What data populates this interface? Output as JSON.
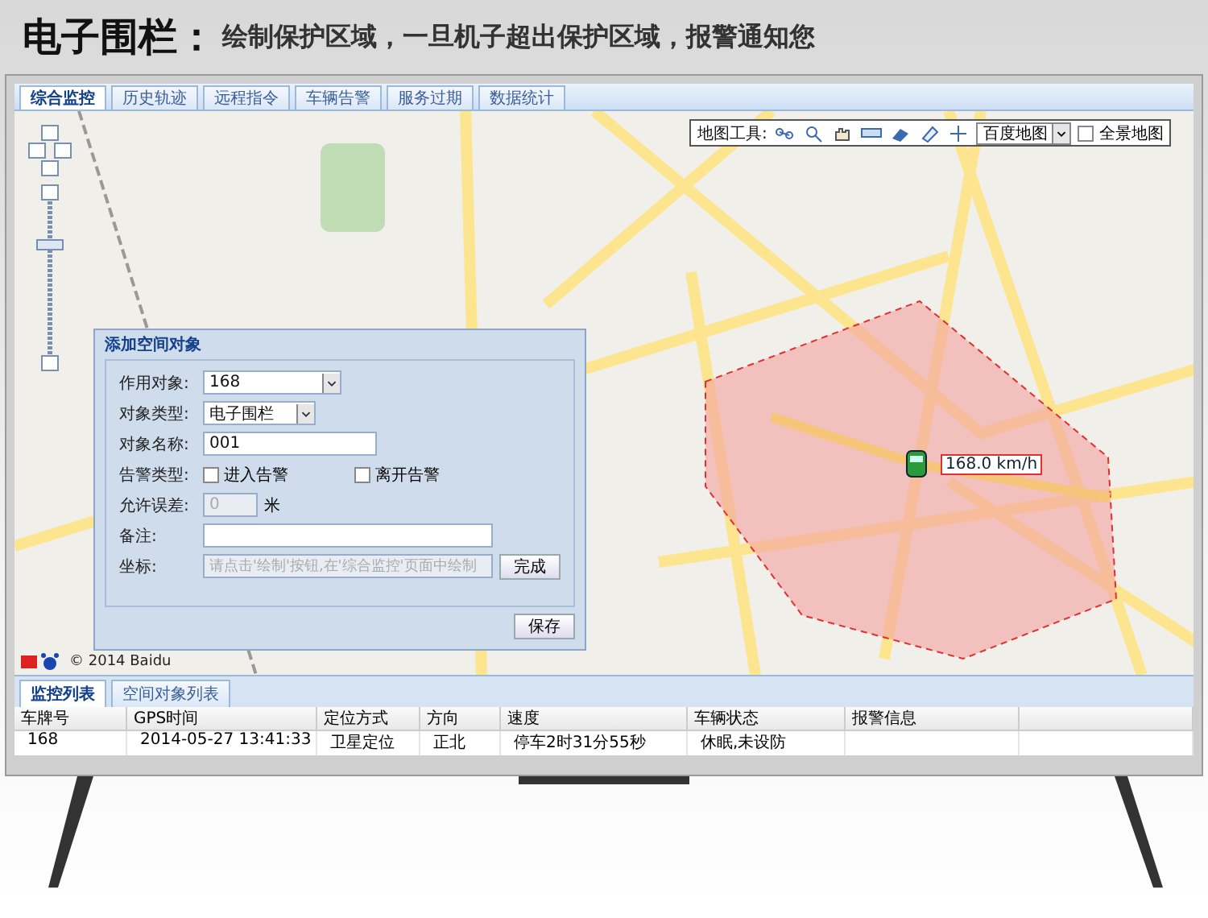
{
  "headline": {
    "title": "电子围栏：",
    "subtitle": "绘制保护区域，一旦机子超出保护区域，报警通知您"
  },
  "tabs": [
    {
      "label": "综合监控",
      "selected": true
    },
    {
      "label": "历史轨迹",
      "selected": false
    },
    {
      "label": "远程指令",
      "selected": false
    },
    {
      "label": "车辆告警",
      "selected": false
    },
    {
      "label": "服务过期",
      "selected": false
    },
    {
      "label": "数据统计",
      "selected": false
    }
  ],
  "map_toolbar": {
    "label": "地图工具:",
    "map_type": "百度地图",
    "panorama": {
      "label": "全景地图",
      "checked": false
    }
  },
  "vehicle": {
    "speed": "168.0 km/h"
  },
  "map_copyright": "© 2014 Baidu",
  "dialog": {
    "title": "添加空间对象",
    "fields": [
      {
        "kind": "select",
        "label": "作用对象:",
        "value": "168"
      },
      {
        "kind": "select",
        "label": "对象类型:",
        "value": "电子围栏"
      },
      {
        "kind": "text",
        "label": "对象名称:",
        "value": "001"
      },
      {
        "kind": "checks",
        "label": "告警类型:",
        "options": [
          {
            "label": "进入告警",
            "checked": false
          },
          {
            "label": "离开告警",
            "checked": false
          }
        ]
      },
      {
        "kind": "number",
        "label": "允许误差:",
        "value": "0",
        "unit": "米",
        "disabled": true
      },
      {
        "kind": "text",
        "label": "备注:"
      },
      {
        "kind": "coords",
        "label": "坐标:",
        "placeholder": "请点击'绘制'按钮,在'综合监控'页面中绘制",
        "button": "完成"
      }
    ],
    "save": "保存"
  },
  "bottom_tabs": [
    {
      "label": "监控列表",
      "selected": true
    },
    {
      "label": "空间对象列表",
      "selected": false
    }
  ],
  "table": {
    "columns": [
      "车牌号",
      "GPS时间",
      "定位方式",
      "方向",
      "速度",
      "车辆状态",
      "报警信息"
    ],
    "rows": [
      [
        "168",
        "2014-05-27 13:41:33",
        "卫星定位",
        "正北",
        "停车2时31分55秒",
        "休眠,未设防"
      ]
    ]
  }
}
